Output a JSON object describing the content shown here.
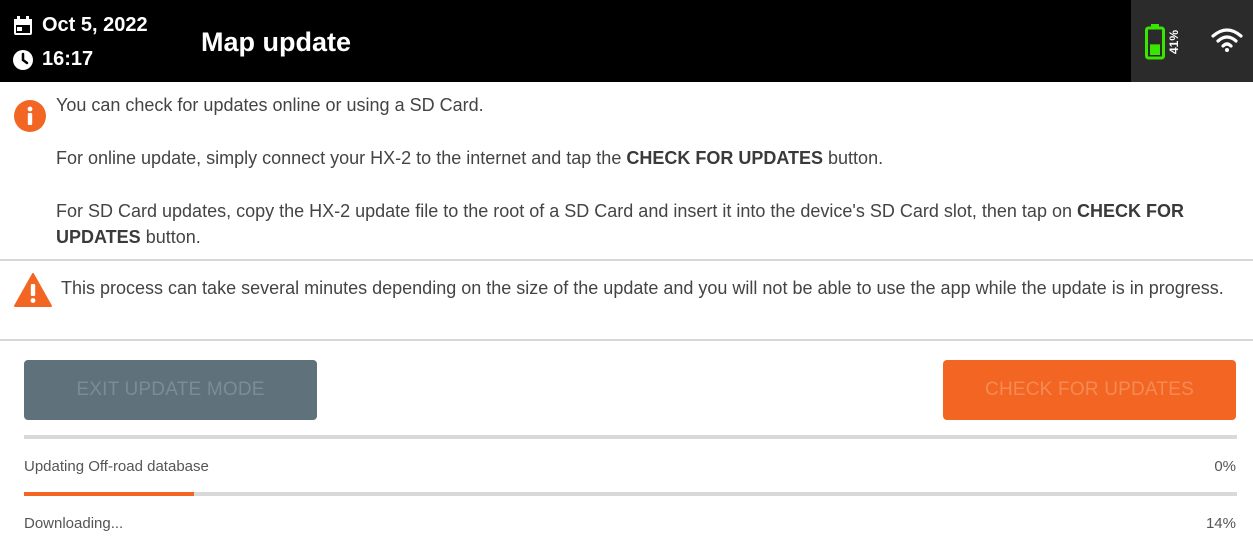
{
  "header": {
    "date": "Oct 5, 2022",
    "time": "16:17",
    "title": "Map update",
    "battery_percent": "41%",
    "battery_level": 0.41,
    "battery_color": "#39e600",
    "date_icon": "calendar-icon",
    "time_icon": "clock-icon",
    "wifi_icon": "wifi-icon"
  },
  "info": {
    "icon": "info-icon",
    "icon_color": "#f26522",
    "line1": "You can check for updates online or using a SD Card.",
    "line2_pre": "For online update, simply connect your HX-2 to the internet and tap the ",
    "line2_bold": "CHECK FOR UPDATES",
    "line2_post": " button.",
    "line3_pre": "For SD Card updates, copy the HX-2 update file to the root of a SD Card and insert it into the device's SD Card slot, then tap on ",
    "line3_bold": "CHECK FOR UPDATES",
    "line3_post": " button."
  },
  "warning": {
    "icon": "warning-icon",
    "icon_color": "#f26522",
    "text": "This process can take several minutes depending on the size of the update and you will not be able to use the app while the update is in progress."
  },
  "buttons": {
    "exit_label": "EXIT UPDATE MODE",
    "check_label": "CHECK FOR UPDATES",
    "check_color": "#f26522"
  },
  "progress": [
    {
      "label": "Updating Off-road database",
      "percent_label": "0%",
      "value": 0.0
    },
    {
      "label": "Downloading...",
      "percent_label": "14%",
      "value": 0.14
    }
  ]
}
